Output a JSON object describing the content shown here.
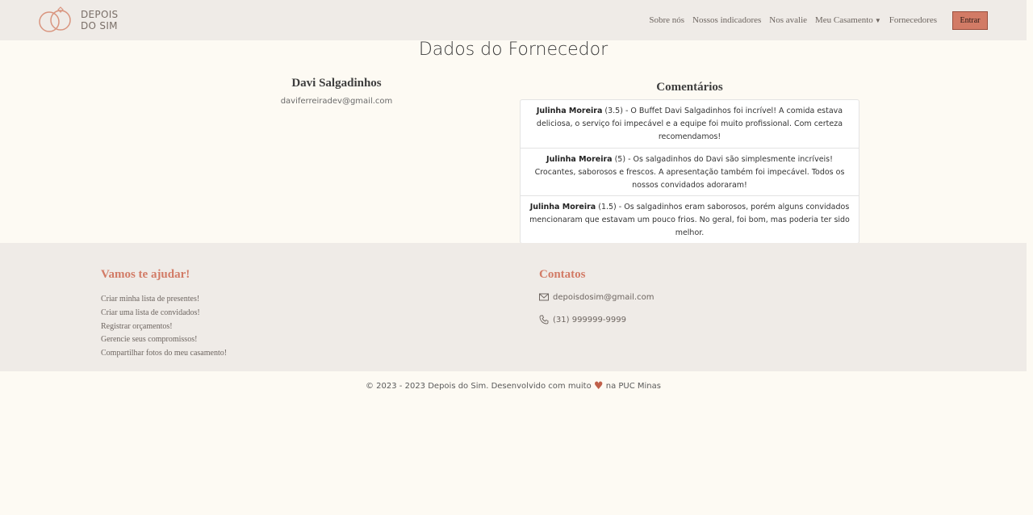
{
  "navbar": {
    "logo_line1": "DEPOIS",
    "logo_line2": "DO SIM",
    "links": [
      "Sobre nós",
      "Nossos indicadores",
      "Nos avalie",
      "Meu Casamento",
      "Fornecedores"
    ],
    "login_label": "Entrar"
  },
  "main": {
    "title": "Dados do Fornecedor",
    "supplier_name": "Davi Salgadinhos",
    "supplier_email": "daviferreiradev@gmail.com",
    "comments_title": "Comentários",
    "comments": [
      {
        "author": "Julinha Moreira",
        "rating": "(3.5)",
        "text": "- O Buffet Davi Salgadinhos foi incrível! A comida estava deliciosa, o serviço foi impecável e a equipe foi muito profissional. Com certeza recomendamos!"
      },
      {
        "author": "Julinha Moreira",
        "rating": "(5)",
        "text": "- Os salgadinhos do Davi são simplesmente incríveis! Crocantes, saborosos e frescos. A apresentação também foi impecável. Todos os nossos convidados adoraram!"
      },
      {
        "author": "Julinha Moreira",
        "rating": "(1.5)",
        "text": "- Os salgadinhos eram saborosos, porém alguns convidados mencionaram que estavam um pouco frios. No geral, foi bom, mas poderia ter sido melhor."
      }
    ]
  },
  "footer": {
    "help_title": "Vamos te ajudar!",
    "help_links": [
      "Criar minha lista de presentes!",
      "Criar uma lista de convidados!",
      "Registrar orçamentos!",
      "Gerencie seus compromissos!",
      "Compartilhar fotos do meu casamento!"
    ],
    "contacts_title": "Contatos",
    "email": "depoisdosim@gmail.com",
    "phone": "(31) 999999-9999"
  },
  "copyright": {
    "before": "© 2023 - 2023 Depois do Sim. Desenvolvido com muito",
    "after": "na PUC Minas"
  },
  "colors": {
    "accent": "#d27b66",
    "navbar_bg": "#efebe7",
    "page_bg": "#fdfaf3"
  },
  "icons": [
    "logo-rings-icon",
    "chevron-down-icon",
    "envelope-icon",
    "phone-icon",
    "heart-icon"
  ]
}
